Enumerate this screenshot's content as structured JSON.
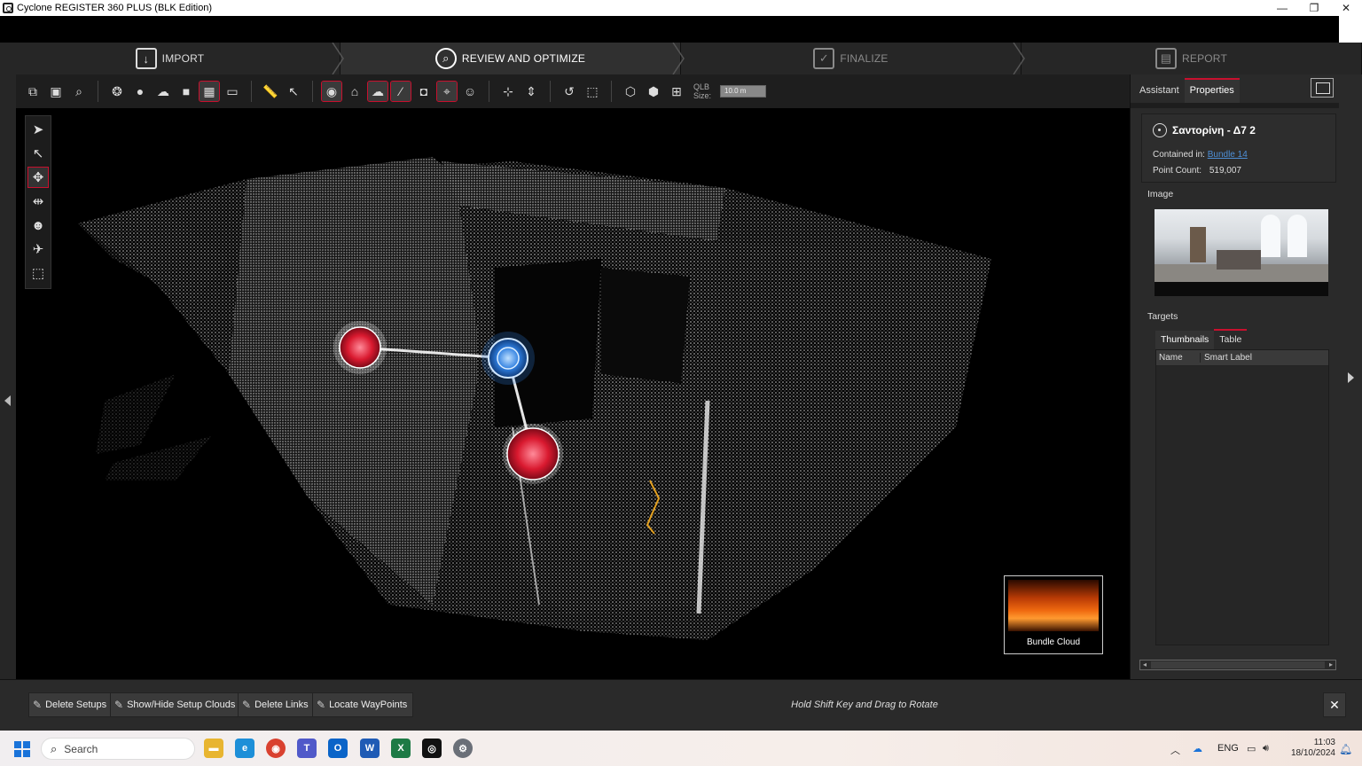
{
  "window": {
    "title": "Cyclone REGISTER 360 PLUS (BLK Edition)",
    "controls": {
      "minimize": "—",
      "restore": "❐",
      "close": "✕"
    }
  },
  "workflow": {
    "steps": [
      {
        "label": "IMPORT",
        "icon": "import-icon"
      },
      {
        "label": "REVIEW AND OPTIMIZE",
        "icon": "review-icon"
      },
      {
        "label": "FINALIZE",
        "icon": "finalize-check-icon"
      },
      {
        "label": "REPORT",
        "icon": "report-icon"
      }
    ],
    "active_step": "REVIEW AND OPTIMIZE"
  },
  "toolbar": {
    "qlb_label_line1": "QLB",
    "qlb_label_line2": "Size:",
    "qlb_value": "10.0 m",
    "accent_color": "#c8102e"
  },
  "viewport": {
    "minimap_label": "Bundle Cloud",
    "setup_colors": {
      "selected": "#d9192f",
      "active": "#2f7fe0"
    }
  },
  "right_panel": {
    "tabs": [
      "Assistant",
      "Properties"
    ],
    "active_tab": "Properties",
    "setup_name": "Σαντορίνη - Δ7 2",
    "contained_in_label": "Contained in:",
    "contained_in_value": "Bundle 14",
    "point_count_label": "Point Count:",
    "point_count_value": "519,007",
    "image_label": "Image",
    "targets_label": "Targets",
    "targets_tabs": [
      "Thumbnails",
      "Table"
    ],
    "targets_columns": [
      "Name",
      "Smart Label"
    ]
  },
  "bottom": {
    "buttons": [
      "Delete Setups",
      "Show/Hide Setup Clouds",
      "Delete Links",
      "Locate WayPoints"
    ],
    "hint": "Hold Shift Key and Drag to Rotate",
    "close": "✕"
  },
  "taskbar": {
    "search_placeholder": "Search",
    "language": "ENG",
    "time": "11:03",
    "date": "18/10/2024"
  }
}
